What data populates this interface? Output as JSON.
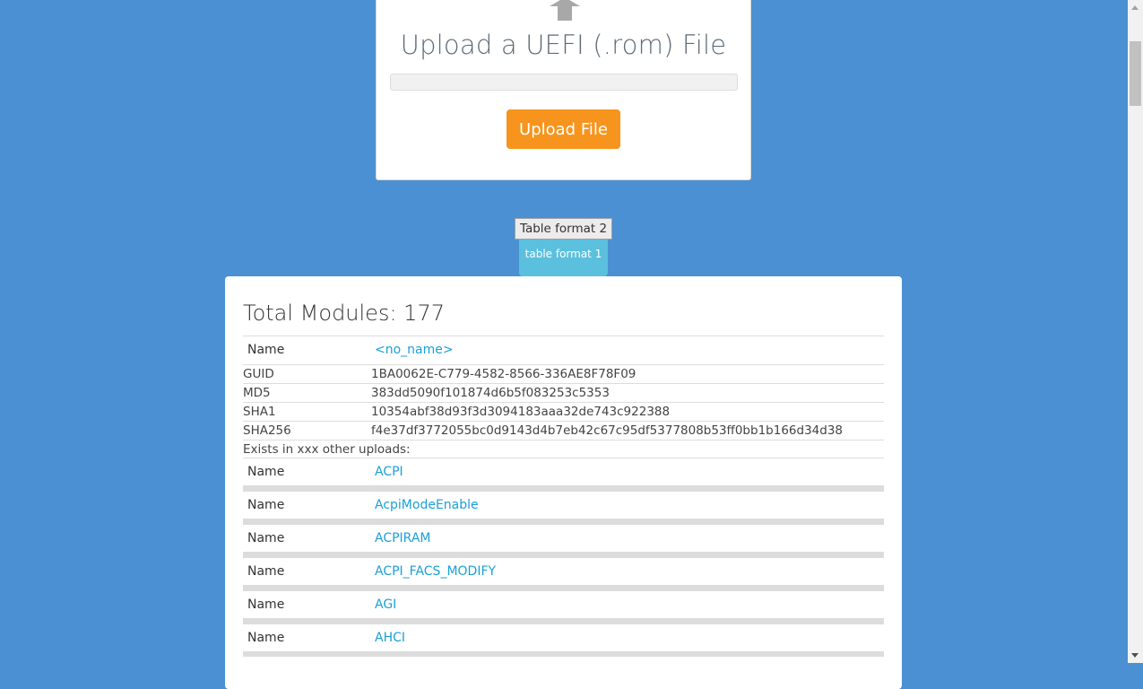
{
  "upload": {
    "icon": "upload-arrow-icon",
    "title": "Upload a UEFI (.rom) File",
    "button_label": "Upload File"
  },
  "format_buttons": {
    "format2": "Table format 2",
    "format1": "table format 1"
  },
  "results": {
    "total": "Total Modules: 177",
    "first": {
      "name_label": "Name",
      "name_value": "<no_name>",
      "fields": [
        {
          "key": "GUID",
          "value": "1BA0062E-C779-4582-8566-336AE8F78F09"
        },
        {
          "key": "MD5",
          "value": "383dd5090f101874d6b5f083253c5353"
        },
        {
          "key": "SHA1",
          "value": "10354abf38d93f3d3094183aaa32de743c922388"
        },
        {
          "key": "SHA256",
          "value": "f4e37df3772055bc0d9143d4b7eb42c67c95df5377808b53ff0bb1b166d34d38"
        }
      ],
      "exists": "Exists in xxx other uploads:"
    },
    "modules": [
      {
        "label": "Name",
        "value": "ACPI"
      },
      {
        "label": "Name",
        "value": "AcpiModeEnable"
      },
      {
        "label": "Name",
        "value": "ACPIRAM"
      },
      {
        "label": "Name",
        "value": "ACPI_FACS_MODIFY"
      },
      {
        "label": "Name",
        "value": "AGI"
      },
      {
        "label": "Name",
        "value": "AHCI"
      }
    ]
  },
  "colors": {
    "background": "#4a90d3",
    "accent_orange": "#f7941d",
    "link": "#1aa0d8",
    "tab_blue": "#5bc0de"
  }
}
